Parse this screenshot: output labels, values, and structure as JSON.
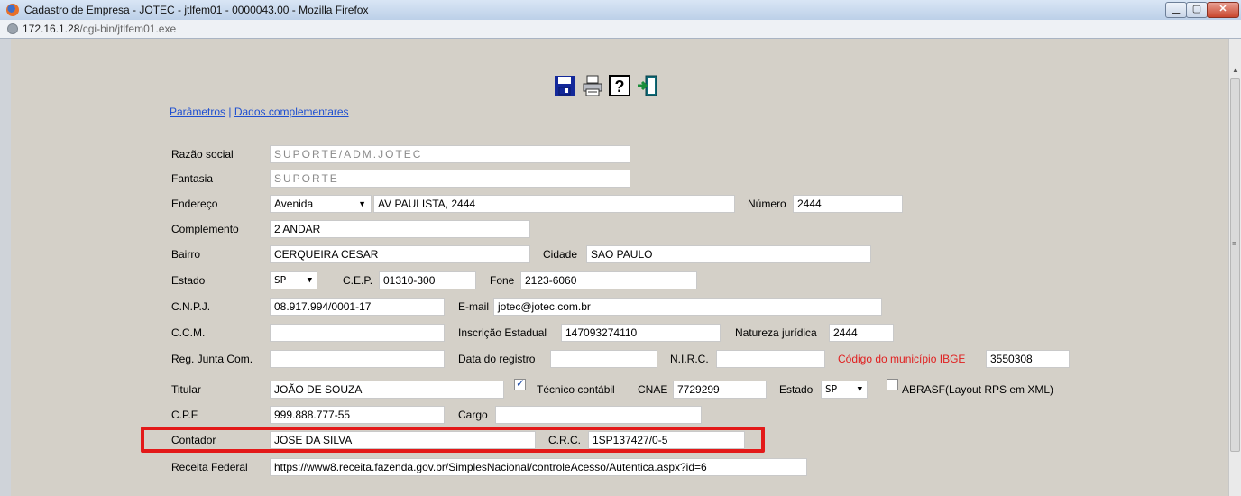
{
  "window": {
    "title": "Cadastro de Empresa - JOTEC - jtlfem01 - 0000043.00 - Mozilla Firefox"
  },
  "urlbar": {
    "host": "172.16.1.28",
    "path": "/cgi-bin/jtlfem01.exe"
  },
  "toolbar": {
    "icons": [
      "save-icon",
      "print-icon",
      "help-icon",
      "exit-icon"
    ]
  },
  "nav": {
    "link1": "Parâmetros",
    "separator": " | ",
    "link2": "Dados complementares"
  },
  "form": {
    "razao_social": {
      "label": "Razão social",
      "value": "SUPORTE/ADM.JOTEC"
    },
    "fantasia": {
      "label": "Fantasia",
      "value": "SUPORTE"
    },
    "endereco": {
      "label": "Endereço",
      "tipo": "Avenida",
      "value": "AV PAULISTA, 2444"
    },
    "numero": {
      "label": "Número",
      "value": "2444"
    },
    "complemento": {
      "label": "Complemento",
      "value": "2 ANDAR"
    },
    "bairro": {
      "label": "Bairro",
      "value": "CERQUEIRA CESAR"
    },
    "cidade": {
      "label": "Cidade",
      "value": "SAO PAULO"
    },
    "estado": {
      "label": "Estado",
      "value": "SP"
    },
    "cep": {
      "label": "C.E.P.",
      "value": "01310-300"
    },
    "fone": {
      "label": "Fone",
      "value": "2123-6060"
    },
    "cnpj": {
      "label": "C.N.P.J.",
      "value": "08.917.994/0001-17"
    },
    "email": {
      "label": "E-mail",
      "value": "jotec@jotec.com.br"
    },
    "ccm": {
      "label": "C.C.M.",
      "value": ""
    },
    "inscricao_estadual": {
      "label": "Inscrição Estadual",
      "value": "147093274110"
    },
    "natureza_juridica": {
      "label": "Natureza jurídica",
      "value": "2444"
    },
    "reg_junta": {
      "label": "Reg. Junta Com.",
      "value": ""
    },
    "data_registro": {
      "label": "Data do registro",
      "value": ""
    },
    "nirc": {
      "label": "N.I.R.C.",
      "value": ""
    },
    "codigo_ibge": {
      "label": "Código do município IBGE",
      "value": "3550308"
    },
    "titular": {
      "label": "Titular",
      "value": "JOÃO DE SOUZA"
    },
    "tecnico_contabil": {
      "label": "Técnico contábil",
      "checked": true
    },
    "cnae": {
      "label": "CNAE",
      "value": "7729299"
    },
    "estado2": {
      "label": "Estado",
      "value": "SP"
    },
    "abrasf": {
      "label": "ABRASF(Layout RPS em XML)",
      "checked": false
    },
    "cpf": {
      "label": "C.P.F.",
      "value": "999.888.777-55"
    },
    "cargo": {
      "label": "Cargo",
      "value": ""
    },
    "contador": {
      "label": "Contador",
      "value": "JOSE DA SILVA"
    },
    "crc": {
      "label": "C.R.C.",
      "value": "1SP137427/0-5"
    },
    "receita_federal": {
      "label": "Receita Federal",
      "value": "https://www8.receita.fazenda.gov.br/SimplesNacional/controleAcesso/Autentica.aspx?id=6"
    }
  },
  "colors": {
    "highlight": "#e31919",
    "link": "#1f4fd0",
    "ibge_label": "#e02020"
  }
}
